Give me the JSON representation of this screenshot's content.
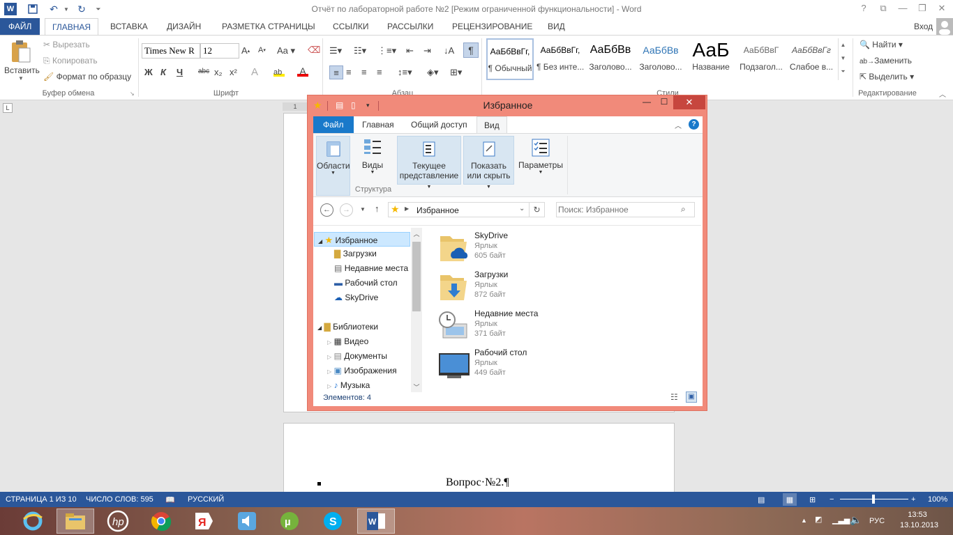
{
  "word": {
    "title": "Отчёт по лабораторной работе №2 [Режим ограниченной функциональности] - Word",
    "help": "?",
    "signin": "Вход",
    "tabs": [
      "ФАЙЛ",
      "ГЛАВНАЯ",
      "ВСТАВКА",
      "ДИЗАЙН",
      "РАЗМЕТКА СТРАНИЦЫ",
      "ССЫЛКИ",
      "РАССЫЛКИ",
      "РЕЦЕНЗИРОВАНИЕ",
      "ВИД"
    ],
    "clipboard": {
      "paste": "Вставить",
      "cut": "Вырезать",
      "copy": "Копировать",
      "format_painter": "Формат по образцу",
      "group": "Буфер обмена"
    },
    "font": {
      "name": "Times New R",
      "size": "12",
      "bold": "Ж",
      "italic": "К",
      "underline": "Ч",
      "strike": "abc",
      "sub": "x₂",
      "sup": "x²",
      "group": "Шрифт"
    },
    "paragraph": {
      "group": "Абзац"
    },
    "styles": {
      "group": "Стили",
      "items": [
        {
          "sample": "АаБбВвГг,",
          "name": "¶ Обычный"
        },
        {
          "sample": "АаБбВвГг,",
          "name": "¶ Без инте..."
        },
        {
          "sample": "АаБбВв",
          "name": "Заголово..."
        },
        {
          "sample": "АаБбВв",
          "name": "Заголово..."
        },
        {
          "sample": "АаБ",
          "name": "Название"
        },
        {
          "sample": "АаБбВвГ",
          "name": "Подзагол..."
        },
        {
          "sample": "АаБбВвГг",
          "name": "Слабое в..."
        }
      ]
    },
    "editing": {
      "find": "Найти",
      "replace": "Заменить",
      "select": "Выделить",
      "group": "Редактирование"
    },
    "ruler_mark": "1",
    "doc_text": "Вопрос·№2.¶",
    "status": {
      "page": "СТРАНИЦА 1 ИЗ 10",
      "words": "ЧИСЛО СЛОВ: 595",
      "lang": "РУССКИЙ",
      "zoom": "100%"
    }
  },
  "explorer": {
    "title": "Избранное",
    "tabs": [
      "Файл",
      "Главная",
      "Общий доступ",
      "Вид"
    ],
    "ribbon": {
      "panes": "Области",
      "views": "Виды",
      "structure": "Структура",
      "current_view_1": "Текущее",
      "current_view_2": "представление",
      "show_hide_1": "Показать",
      "show_hide_2": "или скрыть",
      "options": "Параметры"
    },
    "address": "Избранное",
    "search_placeholder": "Поиск: Избранное",
    "nav": {
      "favorites": "Избранное",
      "downloads": "Загрузки",
      "recent": "Недавние места",
      "desktop": "Рабочий стол",
      "skydrive": "SkyDrive",
      "libraries": "Библиотеки",
      "video": "Видео",
      "documents": "Документы",
      "images": "Изображения",
      "music": "Музыка"
    },
    "files": [
      {
        "name": "SkyDrive",
        "type": "Ярлык",
        "size": "605 байт"
      },
      {
        "name": "Загрузки",
        "type": "Ярлык",
        "size": "872 байт"
      },
      {
        "name": "Недавние места",
        "type": "Ярлык",
        "size": "371 байт"
      },
      {
        "name": "Рабочий стол",
        "type": "Ярлык",
        "size": "449 байт"
      }
    ],
    "status": "Элементов: 4"
  },
  "taskbar": {
    "lang": "РУС",
    "time": "13:53",
    "date": "13.10.2013"
  },
  "colors": {
    "word_blue": "#2b579a",
    "explorer_frame": "#f18a7a",
    "file_tab": "#1979ca"
  }
}
